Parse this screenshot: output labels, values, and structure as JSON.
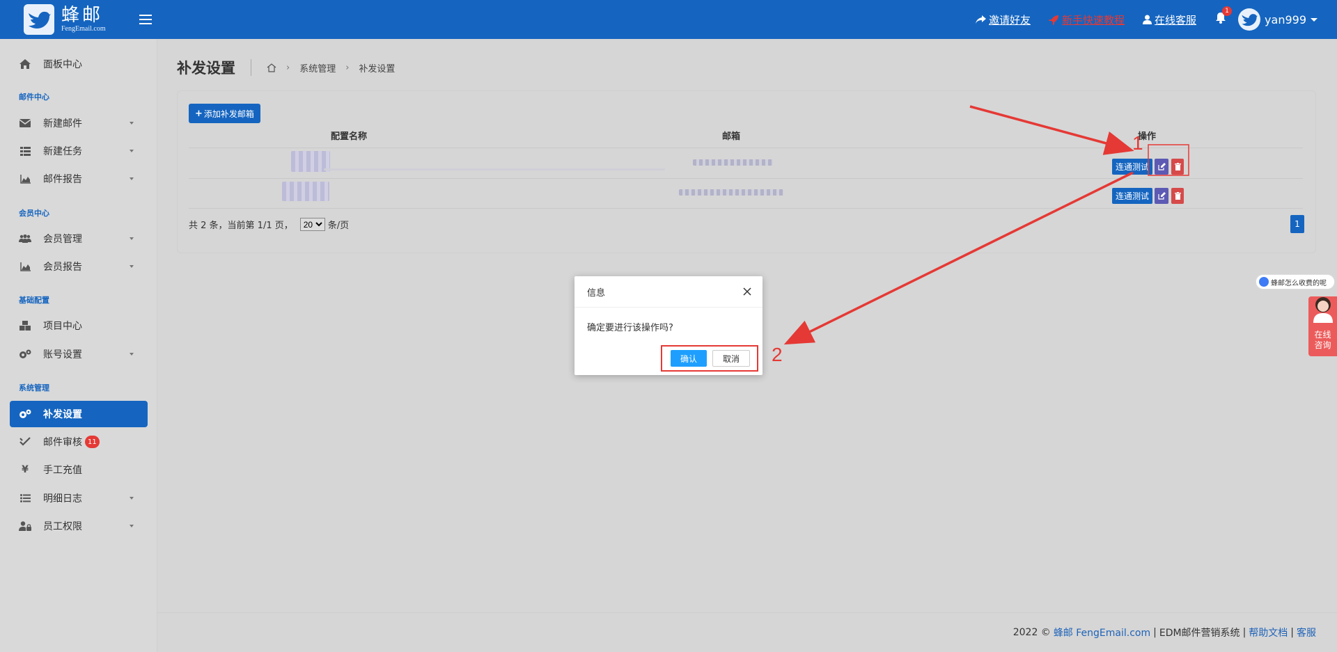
{
  "brand": {
    "name_cn": "蜂邮",
    "name_en": "FengEmail.com"
  },
  "topbar": {
    "invite": "邀请好友",
    "tutorial": "新手快速教程",
    "support": "在线客服",
    "notification_count": "1",
    "username": "yan999"
  },
  "sidebar": {
    "dashboard": "面板中心",
    "section_mail": "邮件中心",
    "new_mail": "新建邮件",
    "new_task": "新建任务",
    "mail_report": "邮件报告",
    "section_member": "会员中心",
    "member_manage": "会员管理",
    "member_report": "会员报告",
    "section_base": "基础配置",
    "project_center": "项目中心",
    "account_settings": "账号设置",
    "section_system": "系统管理",
    "resend_settings": "补发设置",
    "mail_review": "邮件审核",
    "mail_review_badge": "11",
    "manual_recharge": "手工充值",
    "detail_log": "明细日志",
    "staff_permission": "员工权限"
  },
  "page": {
    "title": "补发设置",
    "breadcrumb": [
      "系统管理",
      "补发设置"
    ],
    "add_button": "添加补发邮箱",
    "columns": {
      "name": "配置名称",
      "email": "邮箱",
      "actions": "操作"
    },
    "row_test_label": "连通测试",
    "pager": {
      "summary": "共 2 条，当前第 1/1 页，",
      "page_size": "20",
      "per_page_suffix": "条/页",
      "current_page": "1"
    }
  },
  "footer": {
    "prefix": "2022 ©",
    "brand": "蜂邮 FengEmail.com",
    "sep1": "|",
    "system": "EDM邮件营销系统",
    "sep2": "|",
    "help": "帮助文档",
    "sep3": "|",
    "service": "客服"
  },
  "dialog": {
    "title": "信息",
    "message": "确定要进行该操作吗?",
    "confirm": "确认",
    "cancel": "取消"
  },
  "float_widgets": {
    "chat_bubble": "蜂邮怎么收费的呢",
    "consult": "在线咨询"
  },
  "annotations": {
    "step1": "1",
    "step2": "2"
  },
  "colors": {
    "primary": "#1565c0",
    "danger": "#d64a4a",
    "edit": "#5c5ab3",
    "annotation": "#e53935",
    "dialog_ok": "#1e9fff"
  }
}
